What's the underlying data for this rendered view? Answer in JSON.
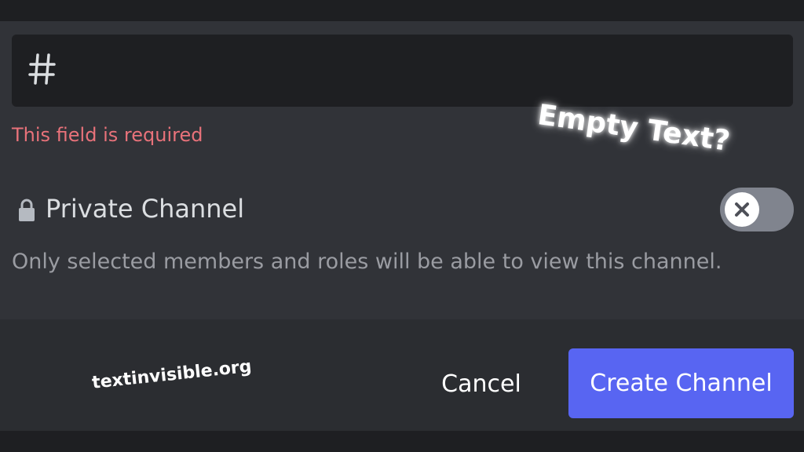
{
  "form": {
    "channel_prefix": "#",
    "channel_name_value": "",
    "error_message": "This field is required"
  },
  "private_channel": {
    "label": "Private Channel",
    "description": "Only selected members and roles will be able to view this channel.",
    "enabled": false,
    "icon": "lock-icon",
    "toggle_icon": "close-icon"
  },
  "footer": {
    "cancel_label": "Cancel",
    "create_label": "Create Channel"
  },
  "overlay": {
    "annotation": "Empty Text?",
    "watermark": "textinvisible.org"
  },
  "colors": {
    "accent": "#5865f2",
    "error": "#e8727a",
    "toggle_off": "#80848e",
    "body_bg": "#313338",
    "footer_bg": "#2b2d31",
    "input_bg": "#1e1f22"
  }
}
